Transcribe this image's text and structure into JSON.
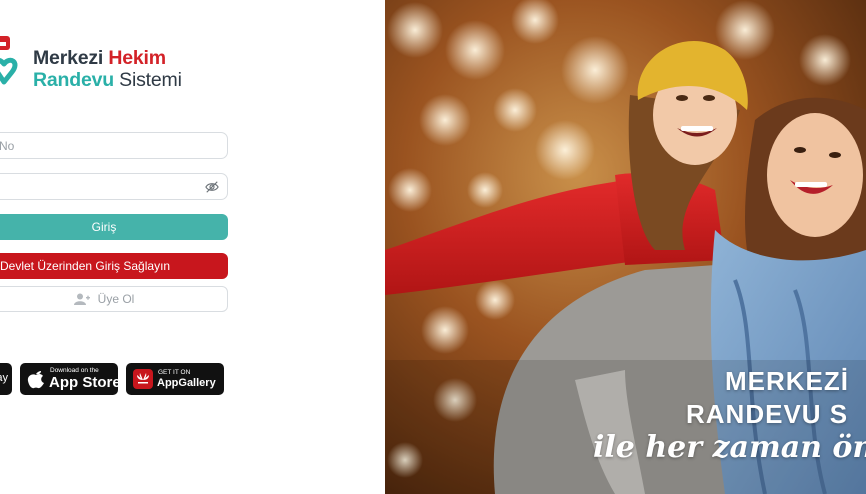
{
  "brand": {
    "line1_part1": "Merkezi ",
    "line1_part2": "Hekim",
    "line2_part1": "Randevu ",
    "line2_part2": "Sistemi"
  },
  "form": {
    "tc_placeholder": "No",
    "password_placeholder": ""
  },
  "buttons": {
    "login": "Giriş",
    "edevlet": "Devlet Üzerinden Giriş Sağlayın",
    "register": "Üye Ol"
  },
  "stores": {
    "google_play_fragment": "ay",
    "apple_small": "Download on the",
    "apple_big": "App Store",
    "huawei_small": "GET IT ON",
    "huawei_big": "AppGallery"
  },
  "hero": {
    "line1": "MERKEZİ",
    "line2": "RANDEVU S",
    "line3": "ile her zaman ön"
  },
  "colors": {
    "brand_red": "#d32228",
    "brand_teal": "#2ab0a8",
    "login_button": "#45b3aa",
    "edevlet_button": "#c8161d"
  },
  "icons": {
    "password_toggle": "eye-off-icon",
    "register": "user-plus-icon",
    "apple": "apple-icon",
    "huawei": "huawei-icon",
    "logo": "heart-logo-icon"
  }
}
